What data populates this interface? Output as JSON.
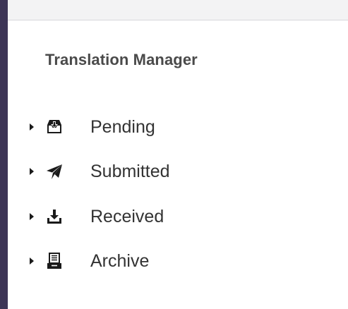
{
  "panel": {
    "title": "Translation Manager"
  },
  "tree": {
    "items": [
      {
        "label": "Pending",
        "icon": "inbox-download-icon",
        "expanded": false
      },
      {
        "label": "Submitted",
        "icon": "paper-plane-icon",
        "expanded": false
      },
      {
        "label": "Received",
        "icon": "tray-download-icon",
        "expanded": false
      },
      {
        "label": "Archive",
        "icon": "archive-box-icon",
        "expanded": false
      }
    ]
  },
  "colors": {
    "rail": "#3d3556",
    "top_bar": "#f3f3f4",
    "title_text": "#4a4a4a",
    "item_text": "#333333",
    "icon": "#1a1a1a"
  }
}
